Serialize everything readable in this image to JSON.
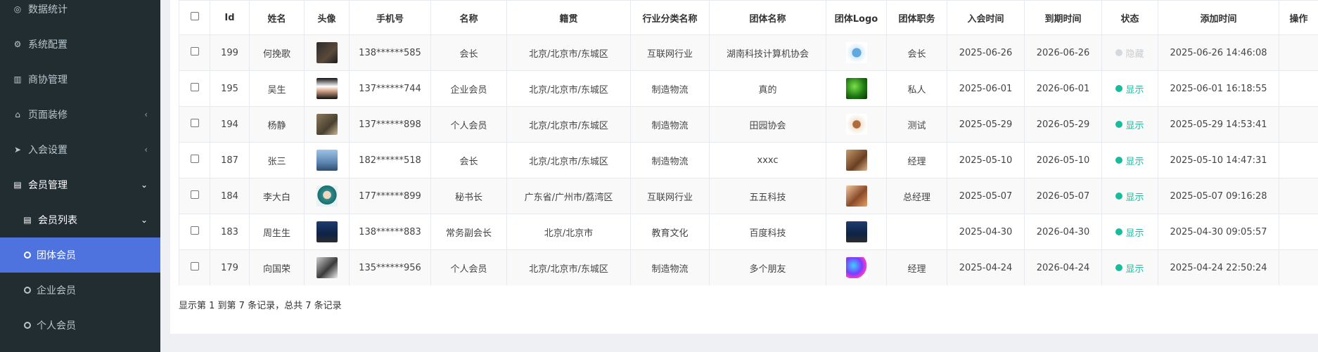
{
  "sidebar": {
    "items": [
      {
        "label": "数据统计",
        "icon": "dashboard-icon",
        "glyph": "◎"
      },
      {
        "label": "系统配置",
        "icon": "gear-icon",
        "glyph": "⚙"
      },
      {
        "label": "商协管理",
        "icon": "bar-chart-icon",
        "glyph": "▥"
      },
      {
        "label": "页面装修",
        "icon": "home-icon",
        "glyph": "⌂",
        "chev": "‹"
      },
      {
        "label": "入会设置",
        "icon": "paper-plane-icon",
        "glyph": "➤",
        "chev": "‹"
      },
      {
        "label": "会员管理",
        "icon": "id-card-icon",
        "glyph": "▤",
        "chev": "⌄"
      },
      {
        "label": "会员列表",
        "icon": "id-card-icon",
        "glyph": "▤",
        "chev": "⌄"
      },
      {
        "label": "团体会员"
      },
      {
        "label": "企业会员"
      },
      {
        "label": "个人会员"
      }
    ]
  },
  "table": {
    "columns": [
      "Id",
      "姓名",
      "头像",
      "手机号",
      "名称",
      "籍贯",
      "行业分类名称",
      "团体名称",
      "团体Logo",
      "团体职务",
      "入会时间",
      "到期时间",
      "状态",
      "添加时间",
      "操作"
    ],
    "rows": [
      {
        "id": "199",
        "name": "何挽歌",
        "phone": "138******585",
        "title": "会长",
        "origin": "北京/北京市/东城区",
        "industry": "互联网行业",
        "group": "湖南科技计算机协会",
        "position": "会长",
        "join": "2025-06-26",
        "expire": "2026-06-26",
        "status": "隐藏",
        "added": "2025-06-26 14:46:08"
      },
      {
        "id": "195",
        "name": "吴生",
        "phone": "137******744",
        "title": "企业会员",
        "origin": "北京/北京市/东城区",
        "industry": "制造物流",
        "group": "真的",
        "position": "私人",
        "join": "2025-06-01",
        "expire": "2026-06-01",
        "status": "显示",
        "added": "2025-06-01 16:18:55"
      },
      {
        "id": "194",
        "name": "杨静",
        "phone": "137******898",
        "title": "个人会员",
        "origin": "北京/北京市/东城区",
        "industry": "制造物流",
        "group": "田园协会",
        "position": "测试",
        "join": "2025-05-29",
        "expire": "2026-05-29",
        "status": "显示",
        "added": "2025-05-29 14:53:41"
      },
      {
        "id": "187",
        "name": "张三",
        "phone": "182******518",
        "title": "会长",
        "origin": "北京/北京市/东城区",
        "industry": "制造物流",
        "group": "xxxc",
        "position": "经理",
        "join": "2025-05-10",
        "expire": "2026-05-10",
        "status": "显示",
        "added": "2025-05-10 14:47:31"
      },
      {
        "id": "184",
        "name": "李大白",
        "phone": "177******899",
        "title": "秘书长",
        "origin": "广东省/广州市/荔湾区",
        "industry": "互联网行业",
        "group": "五五科技",
        "position": "总经理",
        "join": "2025-05-07",
        "expire": "2026-05-07",
        "status": "显示",
        "added": "2025-05-07 09:16:28"
      },
      {
        "id": "183",
        "name": "周生生",
        "phone": "138******883",
        "title": "常务副会长",
        "origin": "北京/北京市",
        "industry": "教育文化",
        "group": "百度科技",
        "position": "",
        "join": "2025-04-30",
        "expire": "2026-04-30",
        "status": "显示",
        "added": "2025-04-30 09:05:57"
      },
      {
        "id": "179",
        "name": "向国荣",
        "phone": "135******956",
        "title": "个人会员",
        "origin": "北京/北京市/东城区",
        "industry": "制造物流",
        "group": "多个朋友",
        "position": "经理",
        "join": "2025-04-24",
        "expire": "2026-04-24",
        "status": "显示",
        "added": "2025-04-24 22:50:24"
      }
    ]
  },
  "footer": {
    "summary": "显示第 1 到第 7 条记录，总共 7 条记录"
  },
  "colors": {
    "sidebar_bg": "#222d32",
    "active_bg": "#4e73df",
    "status_show": "#18bc9c",
    "status_hidden": "#c8ccd0"
  }
}
